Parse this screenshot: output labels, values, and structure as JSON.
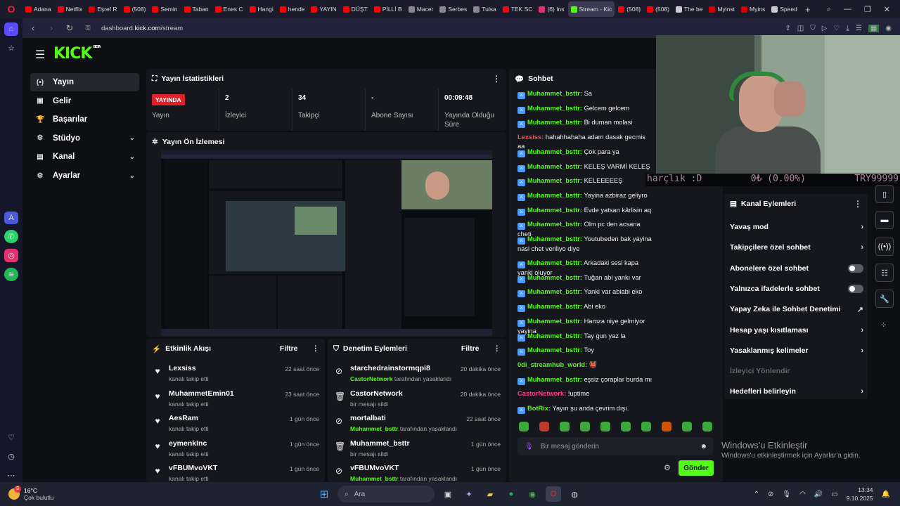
{
  "browser": {
    "tabs": [
      {
        "label": "Adana",
        "color": "#ff0000"
      },
      {
        "label": "Netflix",
        "color": "#e50914"
      },
      {
        "label": "Eşref R",
        "color": "#d40000"
      },
      {
        "label": "(508)",
        "color": "#ff0000"
      },
      {
        "label": "Semin",
        "color": "#ff0000"
      },
      {
        "label": "Taban",
        "color": "#ff0000"
      },
      {
        "label": "Enes C",
        "color": "#ff0000"
      },
      {
        "label": "Hangi",
        "color": "#ff0000"
      },
      {
        "label": "hende",
        "color": "#ff0000"
      },
      {
        "label": "YAYIN",
        "color": "#ff0000"
      },
      {
        "label": "DÜŞT",
        "color": "#ff0000"
      },
      {
        "label": "PİLLİ B",
        "color": "#ff0000"
      },
      {
        "label": "Macer",
        "color": "#888888"
      },
      {
        "label": "Serbes",
        "color": "#888888"
      },
      {
        "label": "Tulsa",
        "color": "#888888"
      },
      {
        "label": "TEK SC",
        "color": "#ff0000"
      },
      {
        "label": "(6) Ins",
        "color": "#e1306c"
      },
      {
        "label": "Stream - Kic",
        "color": "#53fc18",
        "active": true
      },
      {
        "label": "(508)",
        "color": "#ff0000"
      },
      {
        "label": "(508)",
        "color": "#ff0000"
      },
      {
        "label": "The be",
        "color": "#cccccc"
      },
      {
        "label": "Myinst",
        "color": "#d40000"
      },
      {
        "label": "Myins",
        "color": "#d40000"
      },
      {
        "label": "Speed",
        "color": "#cccccc"
      }
    ],
    "new_tab": "+",
    "url_prefix": "dashboard.",
    "url_domain": "kick.com",
    "url_path": "/stream"
  },
  "kick": {
    "logo": "KICK",
    "logo_sup": "BETA",
    "nav": [
      {
        "label": "Yayın",
        "icon": "(•)",
        "active": true,
        "chevron": false
      },
      {
        "label": "Gelir",
        "icon": "▣",
        "chevron": false
      },
      {
        "label": "Başarılar",
        "icon": "🏆",
        "chevron": false
      },
      {
        "label": "Stüdyo",
        "icon": "⚙",
        "chevron": true
      },
      {
        "label": "Kanal",
        "icon": "▤",
        "chevron": true
      },
      {
        "label": "Ayarlar",
        "icon": "⚙",
        "chevron": true
      }
    ]
  },
  "stats": {
    "title": "Yayın İstatistikleri",
    "live_badge": "YAYINDA",
    "live_label": "Yayın",
    "viewers_value": "2",
    "viewers_label": "İzleyici",
    "followers_value": "34",
    "followers_label": "Takipçi",
    "subs_value": "-",
    "subs_label": "Abone Sayısı",
    "duration_value": "00:09:48",
    "duration_label": "Yayında Olduğu Süre"
  },
  "preview": {
    "title": "Yayın Ön İzlemesi"
  },
  "activity": {
    "title": "Etkinlik Akışı",
    "filter": "Filtre",
    "items": [
      {
        "name": "Lexsiss",
        "sub": "kanalı takip etti",
        "time": "22 saat önce"
      },
      {
        "name": "MuhammetEmin01",
        "sub": "kanalı takip etti",
        "time": "23 saat önce"
      },
      {
        "name": "AesRam",
        "sub": "kanalı takip etti",
        "time": "1 gün önce"
      },
      {
        "name": "eymenkInc",
        "sub": "kanalı takip etti",
        "time": "1 gün önce"
      },
      {
        "name": "vFBUMvoVKT",
        "sub": "kanalı takip etti",
        "time": "1 gün önce"
      }
    ]
  },
  "moderation": {
    "title": "Denetim Eylemleri",
    "filter": "Filtre",
    "items": [
      {
        "name": "starchedrainstormqpi8",
        "actor": "CastorNetwork",
        "rest": " tarafından yasaklandı",
        "time": "20 dakika önce",
        "icon": "⊘"
      },
      {
        "name": "CastorNetwork",
        "actor": "",
        "rest": "bir mesajı sildi",
        "time": "20 dakika önce",
        "icon": "🗑"
      },
      {
        "name": "mortalbati",
        "actor": "Muhammet_bsttr",
        "rest": " tarafından yasaklandı",
        "time": "22 saat önce",
        "icon": "⊘"
      },
      {
        "name": "Muhammet_bsttr",
        "actor": "",
        "rest": "bir mesajı sildi",
        "time": "1 gün önce",
        "icon": "🗑"
      },
      {
        "name": "vFBUMvoVKT",
        "actor": "Muhammet_bsttr",
        "rest": " tarafından yasaklandı",
        "time": "1 gün önce",
        "icon": "⊘"
      }
    ]
  },
  "chat": {
    "title": "Sohbet",
    "messages": [
      {
        "user": "Muhammet_bsttr:",
        "text": " Sa",
        "badge": true,
        "color": "green"
      },
      {
        "user": "Muhammet_bsttr:",
        "text": " Gelcem gelcem",
        "badge": true,
        "color": "green"
      },
      {
        "user": "Muhammet_bsttr:",
        "text": " Bi duman molasi",
        "badge": true,
        "color": "green"
      },
      {
        "user": "Lexsiss:",
        "text": " hahahhahaha adam dasak gecmis aa",
        "badge": false,
        "color": "red"
      },
      {
        "user": "Muhammet_bsttr:",
        "text": " Çok para ya",
        "badge": true,
        "color": "green"
      },
      {
        "user": "Muhammet_bsttr:",
        "text": " KELEŞ VARMİ KELEŞ",
        "badge": true,
        "color": "green"
      },
      {
        "user": "Muhammet_bsttr:",
        "text": " KELEEEEEŞ",
        "badge": true,
        "color": "green"
      },
      {
        "user": "Muhammet_bsttr:",
        "text": " Yayina azbiraz geliyro",
        "badge": true,
        "color": "green"
      },
      {
        "user": "Muhammet_bsttr:",
        "text": " Evde yatsan kârlisin aq",
        "badge": true,
        "color": "green"
      },
      {
        "user": "Muhammet_bsttr:",
        "text": " Olm pc den acsana cheti",
        "badge": true,
        "color": "green"
      },
      {
        "user": "Muhammet_bsttr:",
        "text": " Youtubeden bak yayina nasi chet veriliyo diye",
        "badge": true,
        "color": "green"
      },
      {
        "user": "Muhammet_bsttr:",
        "text": " Arkadaki sesi kapa yanki oluyor",
        "badge": true,
        "color": "green"
      },
      {
        "user": "Muhammet_bsttr:",
        "text": " Tuğan abi yankı var",
        "badge": true,
        "color": "green"
      },
      {
        "user": "Muhammet_bsttr:",
        "text": " Yanki var abiabi eko",
        "badge": true,
        "color": "green"
      },
      {
        "user": "Muhammet_bsttr:",
        "text": " Abi eko",
        "badge": true,
        "color": "green"
      },
      {
        "user": "Muhammet_bsttr:",
        "text": " Hamza niye gelmiyor yayina",
        "badge": true,
        "color": "green"
      },
      {
        "user": "Muhammet_bsttr:",
        "text": " Tay gun yaz la",
        "badge": true,
        "color": "green"
      },
      {
        "user": "Muhammet_bsttr:",
        "text": " Toy",
        "badge": true,
        "color": "green"
      },
      {
        "user": "0di_streamhub_world:",
        "text": " 👹",
        "badge": false,
        "color": "green"
      },
      {
        "user": "Muhammet_bsttr:",
        "text": " eşsiz çoraplar burda mı",
        "badge": true,
        "color": "green"
      },
      {
        "user": "CastorNetwork:",
        "text": " !uptime",
        "badge": false,
        "color": "pink"
      },
      {
        "user": "BotRix:",
        "text": " Yayın şu anda çevrim dışı.",
        "badge": true,
        "color": "green"
      }
    ],
    "input_placeholder": "Bir mesaj gönderin",
    "send": "Gönder"
  },
  "ticker": {
    "left": "harçlık :D",
    "mid": "0₺ (0.00%)",
    "right": "TRY99999"
  },
  "channel_actions": {
    "title": "Kanal Eylemleri",
    "items": [
      {
        "label": "Yavaş mod",
        "kind": "chevron"
      },
      {
        "label": "Takipçilere özel sohbet",
        "kind": "chevron"
      },
      {
        "label": "Abonelere özel sohbet",
        "kind": "toggle"
      },
      {
        "label": "Yalnızca ifadelerle sohbet",
        "kind": "toggle"
      },
      {
        "label": "Yapay Zeka ile Sohbet Denetimi",
        "kind": "external"
      },
      {
        "label": "Hesap yaşı kısıtlaması",
        "kind": "chevron"
      },
      {
        "label": "Yasaklanmış kelimeler",
        "kind": "chevron"
      },
      {
        "label": "İzleyici Yönlendir",
        "kind": "dim"
      },
      {
        "label": "Hedefleri belirleyin",
        "kind": "chevron"
      }
    ]
  },
  "windows": {
    "activate_title": "Windows'u Etkinleştir",
    "activate_sub": "Windows'u etkinleştirmek için Ayarlar'a gidin.",
    "weather_temp": "16°C",
    "weather_desc": "Çok bulutlu",
    "search": "Ara",
    "time": "13:34",
    "date": "9.10.2025",
    "notif_count": "3"
  }
}
